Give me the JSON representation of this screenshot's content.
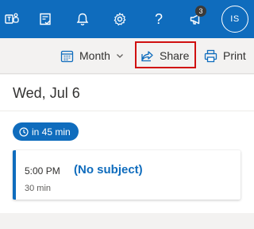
{
  "topbar": {
    "icons": [
      "teams-icon",
      "todo-icon",
      "notifications-icon",
      "settings-icon",
      "help-icon",
      "megaphone-icon"
    ],
    "help_glyph": "?",
    "badge_count": "3",
    "avatar_initials": "IS",
    "background_color": "#0f6cbd"
  },
  "toolbar": {
    "view_label": "Month",
    "share_label": "Share",
    "print_label": "Print",
    "highlight_color": "#d01010"
  },
  "agenda": {
    "date_heading": "Wed, Jul 6",
    "countdown": "in 45 min",
    "event": {
      "time": "5:00 PM",
      "duration": "30 min",
      "subject": "(No subject)"
    }
  }
}
